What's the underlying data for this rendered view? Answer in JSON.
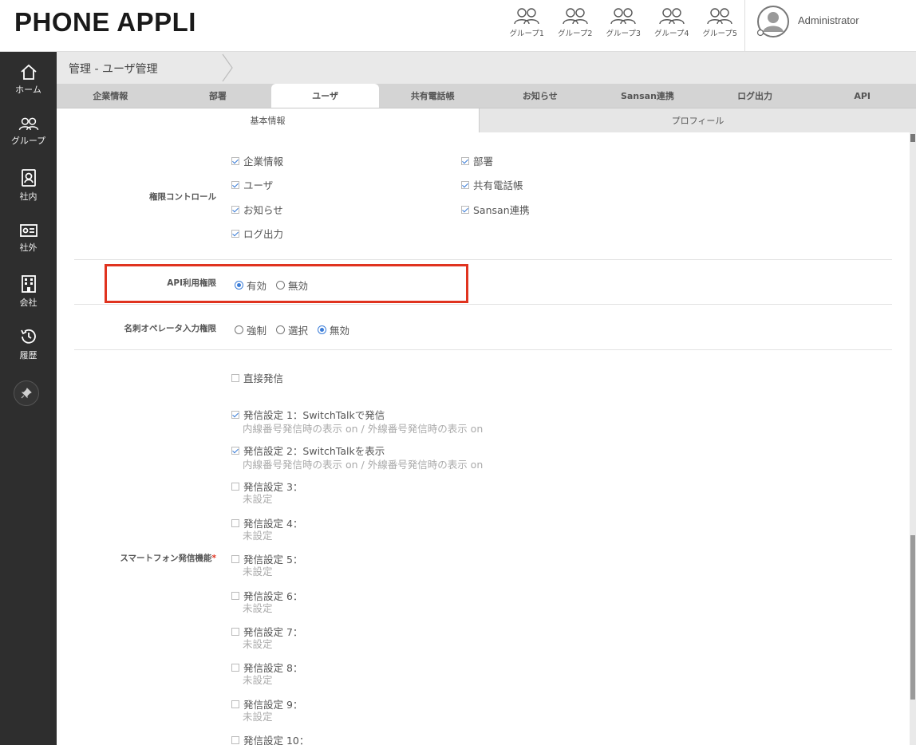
{
  "header": {
    "logo": "PHONE APPLI",
    "groups": [
      "グループ1",
      "グループ2",
      "グループ3",
      "グループ4",
      "グループ5"
    ],
    "user_name": "Administrator"
  },
  "sidebar": {
    "items": [
      {
        "label": "ホーム",
        "icon": "home-icon"
      },
      {
        "label": "グループ",
        "icon": "group-icon"
      },
      {
        "label": "社内",
        "icon": "internal-contacts-icon"
      },
      {
        "label": "社外",
        "icon": "external-contacts-icon"
      },
      {
        "label": "会社",
        "icon": "company-icon"
      },
      {
        "label": "履歴",
        "icon": "history-icon"
      }
    ],
    "pin_icon": "pin-icon"
  },
  "breadcrumb": "管理 - ユーザ管理",
  "tabs": [
    "企業情報",
    "部署",
    "ユーザ",
    "共有電話帳",
    "お知らせ",
    "Sansan連携",
    "ログ出力",
    "API"
  ],
  "active_tab": "ユーザ",
  "subtabs": {
    "basic": "基本情報",
    "profile": "プロフィール"
  },
  "form": {
    "permission_control": {
      "label": "権限コントロール",
      "options": [
        {
          "label": "企業情報",
          "checked": true
        },
        {
          "label": "部署",
          "checked": true
        },
        {
          "label": "ユーザ",
          "checked": true
        },
        {
          "label": "共有電話帳",
          "checked": true
        },
        {
          "label": "お知らせ",
          "checked": true
        },
        {
          "label": "Sansan連携",
          "checked": true
        },
        {
          "label": "ログ出力",
          "checked": true
        }
      ]
    },
    "api_permission": {
      "label": "API利用権限",
      "options": [
        "有効",
        "無効"
      ],
      "selected": "有効"
    },
    "card_operator": {
      "label": "名刺オペレータ入力権限",
      "options": [
        "強制",
        "選択",
        "無効"
      ],
      "selected": "無効"
    },
    "smartphone_call": {
      "label": "スマートフォン発信機能",
      "required_mark": "*",
      "direct_call": {
        "label": "直接発信",
        "checked": false
      },
      "settings": [
        {
          "label": "発信設定 1：SwitchTalkで発信",
          "sub": "内線番号発信時の表示 on / 外線番号発信時の表示 on",
          "checked": true
        },
        {
          "label": "発信設定 2：SwitchTalkを表示",
          "sub": "内線番号発信時の表示 on / 外線番号発信時の表示 on",
          "checked": true
        },
        {
          "label": "発信設定 3：",
          "sub": "未設定",
          "checked": false
        },
        {
          "label": "発信設定 4：",
          "sub": "未設定",
          "checked": false
        },
        {
          "label": "発信設定 5：",
          "sub": "未設定",
          "checked": false
        },
        {
          "label": "発信設定 6：",
          "sub": "未設定",
          "checked": false
        },
        {
          "label": "発信設定 7：",
          "sub": "未設定",
          "checked": false
        },
        {
          "label": "発信設定 8：",
          "sub": "未設定",
          "checked": false
        },
        {
          "label": "発信設定 9：",
          "sub": "未設定",
          "checked": false
        },
        {
          "label": "発信設定 10：",
          "sub": "",
          "checked": false
        }
      ]
    }
  },
  "colors": {
    "accent": "#3b7dd8",
    "highlight": "#e0331f",
    "sidebar": "#2e2e2e"
  }
}
